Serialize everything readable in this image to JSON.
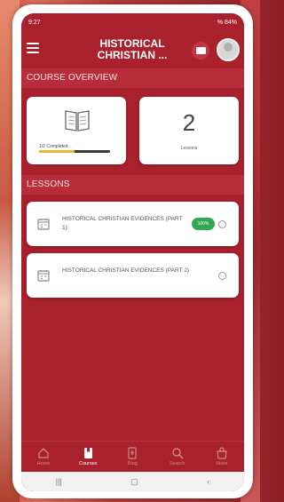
{
  "status": {
    "time": "9:27",
    "right": "% 84%"
  },
  "app": {
    "title_line1": "HISTORICAL",
    "title_line2": "CHRISTIAN ..."
  },
  "overview": {
    "header": "COURSE OVERVIEW",
    "completed_label": "1/2 Completed",
    "progress_fraction": 0.5,
    "lessons_count": "2",
    "lessons_label": "Lessons"
  },
  "lessons": {
    "header": "LESSONS",
    "items": [
      {
        "title": "HISTORICAL CHRISTIAN EVIDENCES (PART 1)",
        "badge": "100%"
      },
      {
        "title": "HISTORICAL CHRISTIAN EVIDENCES (PART 2)"
      }
    ]
  },
  "tabs": [
    "Home",
    "Courses",
    "Blog",
    "Search",
    "Store"
  ],
  "colors": {
    "primary": "#a8212c",
    "accent": "#e8b62f",
    "badge": "#2fa84f"
  }
}
